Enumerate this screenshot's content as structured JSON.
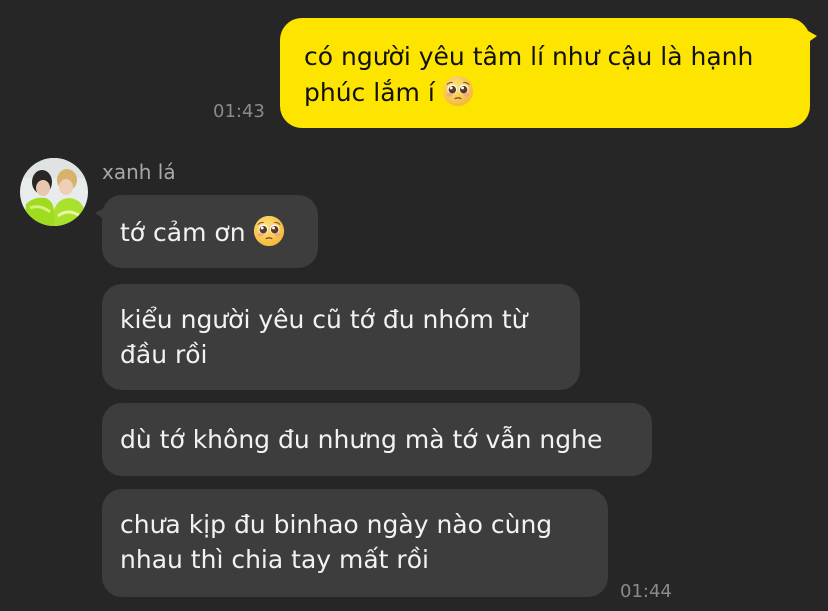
{
  "conversation": {
    "outgoing": {
      "lines": [
        "có người yêu tâm lí như cậu là hạnh",
        "phúc lắm í"
      ],
      "emoji": "pleading-face-icon",
      "time": "01:43",
      "bubble_color": "#FEE500"
    },
    "incoming": {
      "sender_name": "xanh lá",
      "avatar": "avatar-photo",
      "messages": [
        {
          "lines": [
            "tớ cảm ơn"
          ],
          "emoji": "pleading-face-icon"
        },
        {
          "lines": [
            "kiểu người yêu cũ tớ đu nhóm từ",
            "đầu rồi"
          ]
        },
        {
          "lines": [
            "dù tớ không đu nhưng mà tớ vẫn nghe"
          ]
        },
        {
          "lines": [
            "chưa kịp đu binhao ngày nào cùng",
            "nhau thì chia tay mất rồi"
          ]
        }
      ],
      "time": "01:44",
      "bubble_color": "#3d3d3d"
    },
    "background_color": "#262626"
  }
}
